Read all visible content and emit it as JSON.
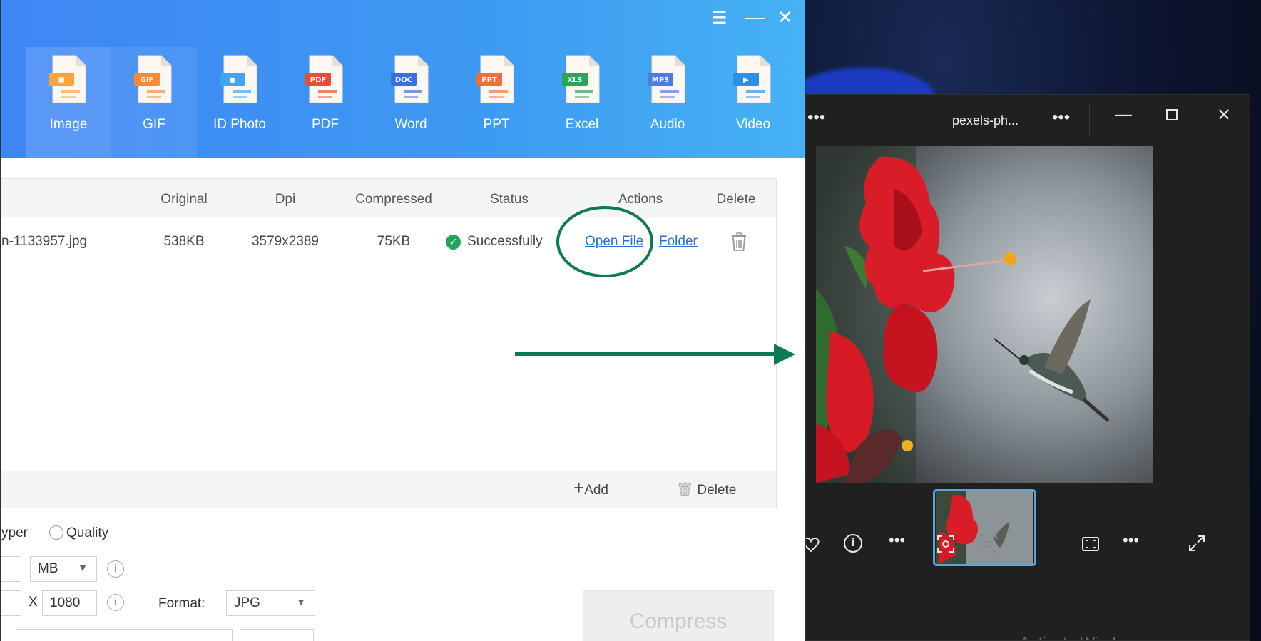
{
  "app": {
    "tabs": [
      {
        "label": "Image",
        "icon": "image-icon",
        "color": "#f7a53a"
      },
      {
        "label": "GIF",
        "icon": "gif-icon",
        "color": "#f28b3a"
      },
      {
        "label": "ID Photo",
        "icon": "id-photo-icon",
        "color": "#3aa7f0"
      },
      {
        "label": "PDF",
        "icon": "pdf-icon",
        "color": "#ec4b3b"
      },
      {
        "label": "Word",
        "icon": "word-icon",
        "color": "#3a6fe0"
      },
      {
        "label": "PPT",
        "icon": "ppt-icon",
        "color": "#f0703a"
      },
      {
        "label": "Excel",
        "icon": "excel-icon",
        "color": "#2aa55a"
      },
      {
        "label": "Audio",
        "icon": "audio-icon",
        "color": "#4a7be8"
      },
      {
        "label": "Video",
        "icon": "video-icon",
        "color": "#2f8fe8"
      }
    ],
    "table": {
      "headers": {
        "original": "Original",
        "dpi": "Dpi",
        "compressed": "Compressed",
        "status": "Status",
        "actions": "Actions",
        "delete": "Delete"
      },
      "row": {
        "filename": "n-1133957.jpg",
        "original": "538KB",
        "dpi": "3579x2389",
        "compressed": "75KB",
        "status": "Successfully",
        "open_file": "Open File",
        "folder": "Folder"
      },
      "footer": {
        "add": "Add",
        "delete": "Delete"
      }
    },
    "settings": {
      "mode_partial": "yper",
      "quality_label": "Quality",
      "unit": "MB",
      "x_label": "X",
      "height": "1080",
      "format_label": "Format:",
      "format": "JPG"
    },
    "compress_label": "Compress"
  },
  "viewer": {
    "title": "pexels-ph...",
    "watermark": "Activate Wind"
  },
  "colors": {
    "accent": "#3d8df4",
    "annotation": "#0d7a50",
    "link": "#2c6fd6",
    "success": "#22a55a"
  }
}
